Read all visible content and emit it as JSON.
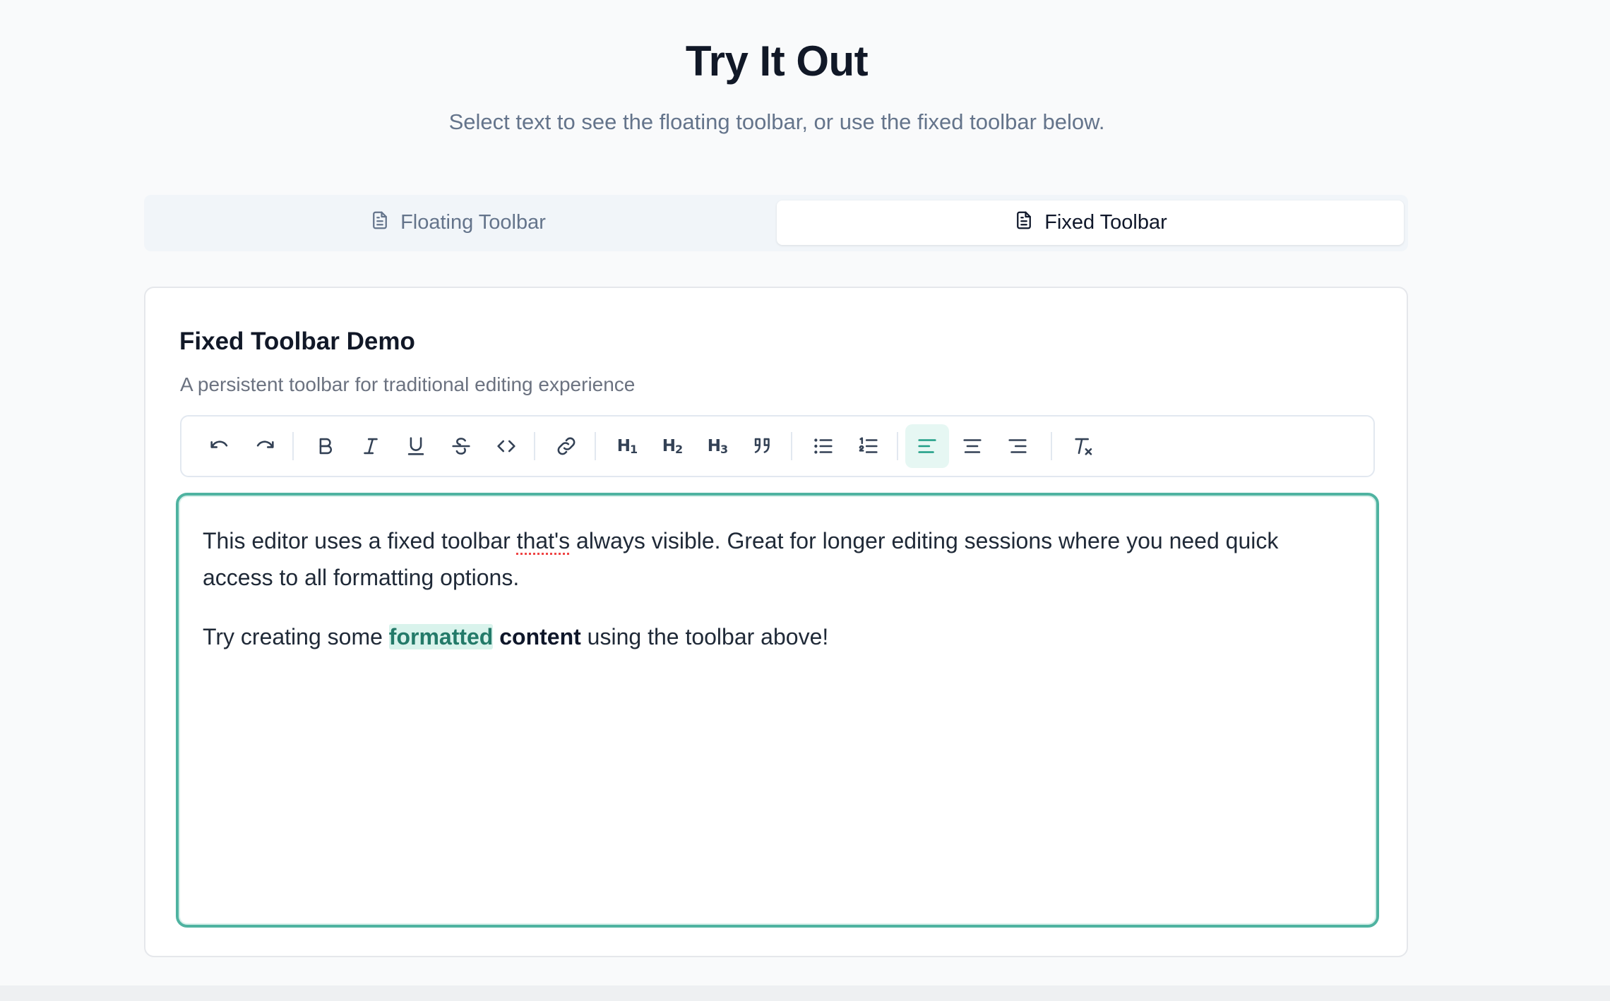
{
  "header": {
    "title": "Try It Out",
    "subtitle": "Select text to see the floating toolbar, or use the fixed toolbar below."
  },
  "tabs": [
    {
      "label": "Floating Toolbar",
      "icon": "document-icon",
      "active": false
    },
    {
      "label": "Fixed Toolbar",
      "icon": "document-icon",
      "active": true
    }
  ],
  "card": {
    "title": "Fixed Toolbar Demo",
    "description": "A persistent toolbar for traditional editing experience"
  },
  "toolbar": {
    "heading1": {
      "main": "H",
      "sub": "1"
    },
    "heading2": {
      "main": "H",
      "sub": "2"
    },
    "heading3": {
      "main": "H",
      "sub": "3"
    },
    "active_color": "#1f9e86",
    "active_background": "#e6f7f3",
    "active_button": "align-left"
  },
  "editor": {
    "paragraph1": {
      "before": "This editor uses a fixed toolbar ",
      "misspelled": "that's",
      "after": " always visible. Great for longer editing sessions where you need quick access to all formatting options."
    },
    "paragraph2": {
      "before": "Try creating some ",
      "highlighted": "formatted",
      "space": " ",
      "bold": "content",
      "after": " using the toolbar above!"
    },
    "focus_border_color": "#4fb3a1"
  }
}
